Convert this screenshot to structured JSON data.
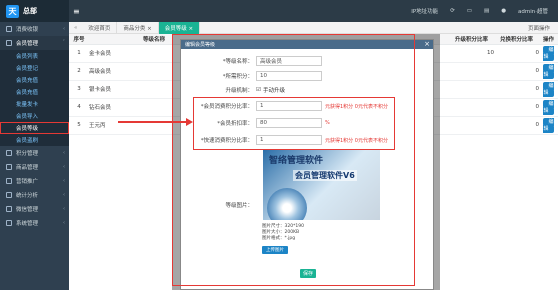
{
  "app": {
    "brand": "总部"
  },
  "sidebar": {
    "items": [
      {
        "label": "消费收银",
        "icon": "cash-icon"
      },
      {
        "label": "会员管理",
        "icon": "user-icon"
      }
    ],
    "subitems": [
      "会员列表",
      "会员登记",
      "会员充值",
      "会员充值",
      "批量发卡",
      "会员导入",
      "会员等级",
      "会员盗刷"
    ],
    "items2": [
      {
        "label": "积分管理"
      },
      {
        "label": "商品管理"
      },
      {
        "label": "营销推广"
      },
      {
        "label": "统计分析"
      },
      {
        "label": "微信管理"
      },
      {
        "label": "系统管理"
      }
    ]
  },
  "topbar": {
    "right1": "IP地址功能",
    "user": "admin·超管"
  },
  "tabs": [
    "欢迎首页",
    "商品分类 ×",
    "会员等级 ×"
  ],
  "tab_right": "页面操作",
  "table": {
    "headers": [
      "序号",
      "等级名称",
      "",
      "",
      "",
      "",
      "",
      "",
      "",
      "升级积分比率",
      "兑换积分比率",
      "操作"
    ],
    "rows": [
      {
        "no": "1",
        "name": "金卡会员",
        "a": "10",
        "b": "0",
        "op": "编辑"
      },
      {
        "no": "2",
        "name": "高级会员",
        "a": "",
        "b": "0",
        "op": "编辑"
      },
      {
        "no": "3",
        "name": "银卡会员",
        "a": "",
        "b": "0",
        "op": "编辑"
      },
      {
        "no": "4",
        "name": "钻石会员",
        "a": "",
        "b": "0",
        "op": "编辑"
      },
      {
        "no": "5",
        "name": "王元丙",
        "a": "",
        "b": "0",
        "op": "编辑"
      }
    ]
  },
  "dialog": {
    "title": "编辑会员等级",
    "name_label": "*等级名称：",
    "name_value": "高级会员",
    "points_label": "*所需积分：",
    "points_value": "10",
    "upgrade_label": "升级机制：",
    "upgrade_value": "手动升级",
    "ratio1_label": "*会员消费积分比率：",
    "ratio1_value": "1",
    "ratio1_hint": "元获得1积分 0元代表不积分",
    "ratio2_label": "*会员折扣率：",
    "ratio2_value": "80",
    "ratio2_hint": "%",
    "ratio3_label": "*快速消费积分比率：",
    "ratio3_value": "1",
    "ratio3_hint": "元获得1积分 0元代表不积分",
    "image_label": "等级图片：",
    "img_text1": "智络管理软件",
    "img_text2": "会员管理软件V6",
    "img_info1": "图片尺寸：320*190",
    "img_info2": "图片大小：200KB",
    "img_info3": "图片格式：*.jpg",
    "upload_label": "上传图片",
    "save_label": "保存"
  }
}
